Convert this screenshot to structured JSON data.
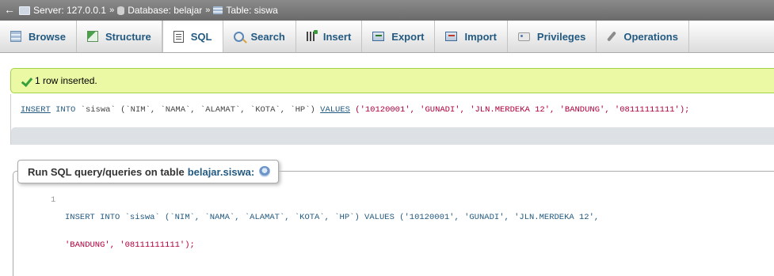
{
  "breadcrumb": {
    "back": "←",
    "server": "Server: 127.0.0.1",
    "database": "Database: belajar",
    "table": "Table: siswa",
    "separator": "»"
  },
  "tabs": [
    {
      "label": "Browse",
      "icon": "browse-icon"
    },
    {
      "label": "Structure",
      "icon": "structure-icon"
    },
    {
      "label": "SQL",
      "icon": "sql-icon",
      "active": true
    },
    {
      "label": "Search",
      "icon": "search-icon"
    },
    {
      "label": "Insert",
      "icon": "insert-icon"
    },
    {
      "label": "Export",
      "icon": "export-icon"
    },
    {
      "label": "Import",
      "icon": "import-icon"
    },
    {
      "label": "Privileges",
      "icon": "privileges-icon"
    },
    {
      "label": "Operations",
      "icon": "wrench-icon"
    }
  ],
  "message": {
    "text": "1 row inserted.",
    "icon": "check-icon"
  },
  "sql_echo": {
    "insert": "INSERT",
    "into": "INTO",
    "table": "`siswa`",
    "columns": "(`NIM`, `NAMA`, `ALAMAT`, `KOTA`, `HP`)",
    "values_kw": "VALUES",
    "values": "('10120001', 'GUNADI', 'JLN.MERDEKA 12', 'BANDUNG', '08111111111');"
  },
  "query_form": {
    "title": "Run SQL query/queries on table",
    "table_link": "belajar.siswa:",
    "help_icon": "help-icon",
    "line_number": "1",
    "line1": "INSERT INTO `siswa` (`NIM`, `NAMA`, `ALAMAT`, `KOTA`, `HP`) VALUES ('10120001', 'GUNADI', 'JLN.MERDEKA 12',",
    "line2": "'BANDUNG', '08111111111');"
  },
  "colors": {
    "accent": "#235a81",
    "success_bg": "#ebf8a4",
    "success_border": "#a2d246",
    "string": "#b0003a"
  }
}
